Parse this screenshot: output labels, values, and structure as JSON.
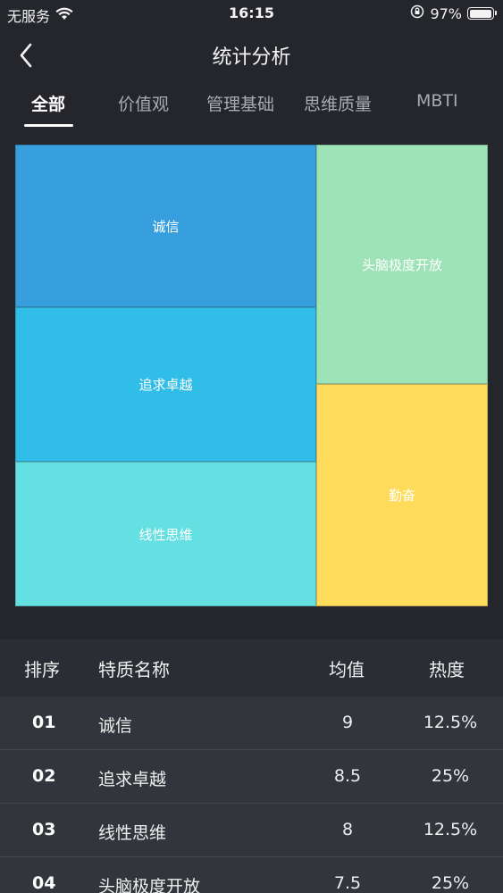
{
  "status": {
    "carrier": "无服务",
    "time": "16:15",
    "battery_percent": "97%",
    "battery_level": 0.97
  },
  "nav": {
    "title": "统计分析",
    "back_icon": "chevron-left-icon"
  },
  "tabs": [
    {
      "label": "全部",
      "active": true
    },
    {
      "label": "价值观",
      "active": false
    },
    {
      "label": "管理基础",
      "active": false
    },
    {
      "label": "思维质量",
      "active": false
    },
    {
      "label": "MBTI",
      "active": false
    }
  ],
  "treemap": {
    "cells": [
      {
        "label": "诚信",
        "color": "#379fdd"
      },
      {
        "label": "追求卓越",
        "color": "#30bde8"
      },
      {
        "label": "线性思维",
        "color": "#64dfe2"
      },
      {
        "label": "头脑极度开放",
        "color": "#9ee3b7"
      },
      {
        "label": "勤奋",
        "color": "#ffdb5c"
      }
    ]
  },
  "table": {
    "headers": {
      "rank": "排序",
      "name": "特质名称",
      "avg": "均值",
      "heat": "热度"
    },
    "rows": [
      {
        "rank": "01",
        "name": "诚信",
        "avg": "9",
        "heat": "12.5%"
      },
      {
        "rank": "02",
        "name": "追求卓越",
        "avg": "8.5",
        "heat": "25%"
      },
      {
        "rank": "03",
        "name": "线性思维",
        "avg": "8",
        "heat": "12.5%"
      },
      {
        "rank": "04",
        "name": "头脑极度开放",
        "avg": "7.5",
        "heat": "25%"
      }
    ]
  }
}
